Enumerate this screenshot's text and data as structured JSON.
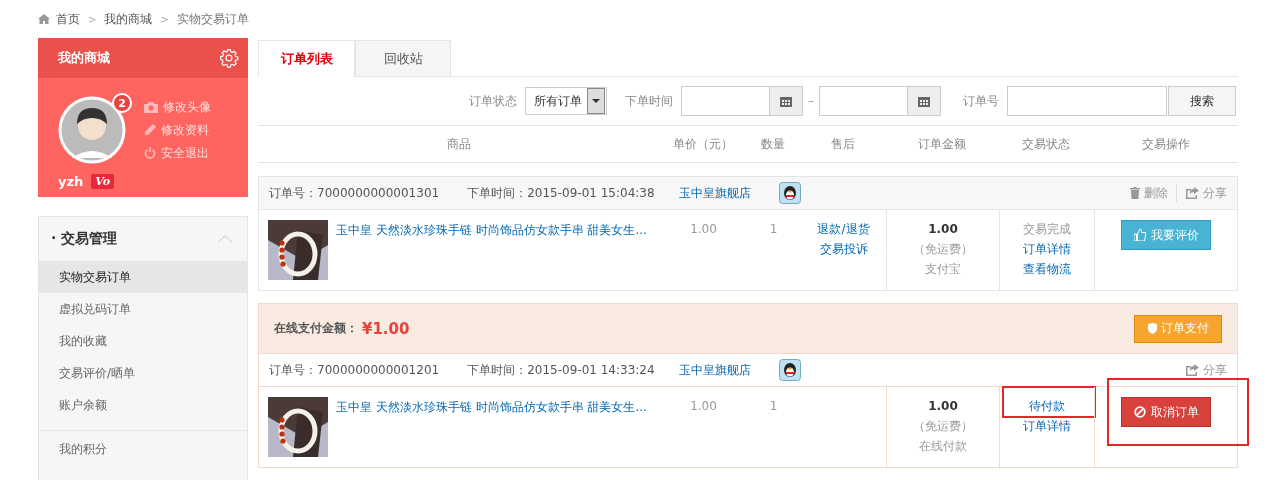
{
  "breadcrumb": [
    "首页",
    "我的商城",
    "实物交易订单"
  ],
  "breadcrumb_separator": ">",
  "sidebar": {
    "title": "我的商城",
    "badge": "2",
    "profile_links": [
      {
        "kind": "camera",
        "label": "修改头像"
      },
      {
        "kind": "pencil",
        "label": "修改资料"
      },
      {
        "kind": "power",
        "label": "安全退出"
      }
    ],
    "username": "yzh",
    "level_badge": "Vo",
    "section": {
      "title": "· 交易管理",
      "expanded": true,
      "items": [
        {
          "label": "实物交易订单",
          "selected": true
        },
        {
          "label": "虚拟兑码订单",
          "selected": false
        },
        {
          "label": "我的收藏",
          "selected": false
        },
        {
          "label": "交易评价/晒单",
          "selected": false
        },
        {
          "label": "账户余额",
          "selected": false
        }
      ]
    },
    "extra_items": [
      {
        "label": "我的积分",
        "selected": false
      }
    ]
  },
  "tabs": [
    {
      "label": "订单列表",
      "selected": true
    },
    {
      "label": "回收站",
      "selected": false
    }
  ],
  "filters": {
    "status_label": "订单状态",
    "status_value": "所有订单",
    "time_label": "下单时间",
    "time_sep": "–",
    "number_label": "订单号",
    "search_button": "搜索"
  },
  "columns": [
    "商品",
    "单价（元）",
    "数量",
    "售后",
    "订单金额",
    "交易状态",
    "交易操作"
  ],
  "orders": [
    {
      "number": "订单号：7000000000001301",
      "time": "下单时间：2015-09-01 15:04:38",
      "shop": "玉中皇旗舰店",
      "header_actions": [
        {
          "kind": "delete",
          "label": "删除"
        },
        {
          "kind": "share",
          "label": "分享"
        }
      ],
      "title": "玉中皇 天然淡水珍珠手链 时尚饰品仿女款手串 甜美女生...",
      "price": "1.00",
      "qty": "1",
      "after_sale": [
        "退款/退货",
        "交易投诉"
      ],
      "amount": "1.00",
      "shipping": "（免运费）",
      "payment_method": "支付宝",
      "status": {
        "kind": "plain",
        "label": "交易完成"
      },
      "status_links": [
        "订单详情",
        "查看物流"
      ],
      "action": {
        "kind": "review",
        "label": "我要评价"
      },
      "highlighted": false
    },
    {
      "payment_banner": {
        "label": "在线支付金额：",
        "amount": "¥1.00",
        "button": "订单支付"
      },
      "number": "订单号：7000000000001201",
      "time": "下单时间：2015-09-01 14:33:24",
      "shop": "玉中皇旗舰店",
      "header_actions": [
        {
          "kind": "share",
          "label": "分享"
        }
      ],
      "title": "玉中皇 天然淡水珍珠手链 时尚饰品仿女款手串 甜美女生...",
      "price": "1.00",
      "qty": "1",
      "amount": "1.00",
      "shipping": "（免运费）",
      "payment_method": "在线付款",
      "status": {
        "kind": "link",
        "label": "待付款"
      },
      "status_links": [
        "订单详情"
      ],
      "action": {
        "kind": "cancel",
        "label": "取消订单"
      },
      "highlighted": true
    }
  ]
}
